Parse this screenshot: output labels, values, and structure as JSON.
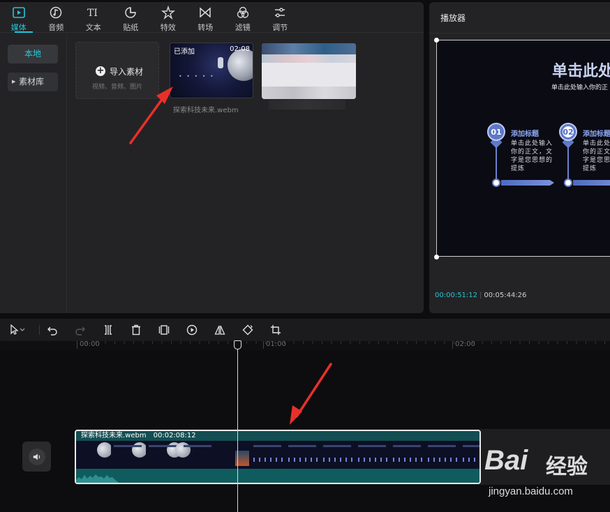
{
  "categories": [
    {
      "label": "媒体",
      "icon": "play-square-icon",
      "active": true
    },
    {
      "label": "音频",
      "icon": "music-note-icon"
    },
    {
      "label": "文本",
      "icon": "text-ti-icon"
    },
    {
      "label": "贴纸",
      "icon": "sticker-icon"
    },
    {
      "label": "特效",
      "icon": "sparkle-star-icon"
    },
    {
      "label": "转场",
      "icon": "transition-bowtie-icon"
    },
    {
      "label": "滤镜",
      "icon": "filter-circles-icon"
    },
    {
      "label": "调节",
      "icon": "sliders-icon"
    }
  ],
  "sidenav": {
    "local": "本地",
    "library": "素材库"
  },
  "import": {
    "label": "导入素材",
    "hint": "视频、音频、图片"
  },
  "media_clip": {
    "badge": "已添加",
    "duration": "02:08",
    "name": "探索科技未来.webm"
  },
  "player": {
    "title": "播放器",
    "slide_title": "单击此处",
    "slide_subtitle": "单击此处输入你的正",
    "steps": [
      {
        "num": "01",
        "title": "添加标题",
        "body": "单击此处输入你的正文，文字是您思想的提炼"
      },
      {
        "num": "02",
        "title": "添加标题",
        "body": "单击此处输入你的正文，文字是您思想的提炼"
      }
    ],
    "current_time": "00:00:51:12",
    "total_time": "00:05:44:26"
  },
  "toolbar": [
    "select-cursor-icon",
    "undo-icon",
    "redo-icon",
    "split-icon",
    "delete-icon",
    "freeze-icon",
    "reverse-play-icon",
    "mirror-icon",
    "rotate-icon",
    "crop-icon"
  ],
  "ruler": {
    "labels": [
      "00:00",
      "01:00",
      "02:00"
    ]
  },
  "timeline_clip": {
    "name": "探索科技未来.webm",
    "duration": "00:02:08:12"
  },
  "watermark": {
    "brand": "Bai",
    "brand_cn": "经验",
    "url": "jingyan.baidu.com"
  },
  "colors": {
    "accent": "#22c6d8",
    "clip": "#125f61",
    "arrow": "#e8302a"
  }
}
